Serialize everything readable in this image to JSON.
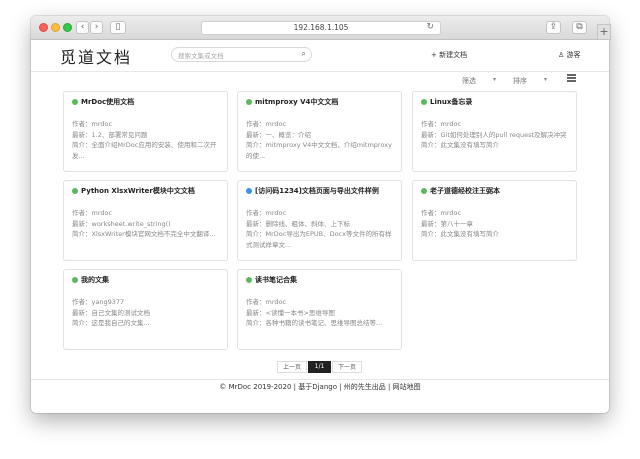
{
  "browser": {
    "url": "192.168.1.105",
    "back_glyph": "‹",
    "forward_glyph": "›",
    "sidebar_glyph": "▯",
    "reload_glyph": "↻",
    "share_glyph": "⇪",
    "tabs_glyph": "⧉",
    "plus_glyph": "+"
  },
  "header": {
    "logo": "觅道文档",
    "search_placeholder": "搜索文集或文档",
    "search_icon": "⌕",
    "new_doc": "+ 新建文档",
    "guest": "♙ 游客"
  },
  "toolbar": {
    "filter_label": "筛选",
    "sort_label": "排序",
    "caret": "▾"
  },
  "cards": [
    {
      "title": "MrDoc使用文档",
      "dot": "green",
      "author": "作者：mrdoc",
      "latest": "最新：1.2、部署常见问题",
      "intro": "简介：全面介绍MrDoc应用的安装、使用和二次开发..."
    },
    {
      "title": "mitmproxy V4中文文档",
      "dot": "green",
      "author": "作者：mrdoc",
      "latest": "最新：一、概览：介绍",
      "intro": "简介：mitmproxy V4中文文档，介绍mitmproxy的使..."
    },
    {
      "title": "Linux备忘录",
      "dot": "green",
      "author": "作者：mrdoc",
      "latest": "最新：Git如何处理别人的pull request及解决冲突",
      "intro": "简介：此文集没有填写简介"
    },
    {
      "title": "Python XlsxWriter模块中文文档",
      "dot": "green",
      "author": "作者：mrdoc",
      "latest": "最新：worksheet.write_string()",
      "intro": "简介：XlsxWriter模块官网文档不完全中文翻译..."
    },
    {
      "title": "[访问码1234]文档页面与导出文件样例",
      "dot": "blue",
      "author": "作者：mrdoc",
      "latest": "最新：删除线、粗体、斜体、上下标",
      "intro": "简介：MrDoc导出为EPUB、Docx等文件的所有样式测试样章文..."
    },
    {
      "title": "老子道德经校注王弼本",
      "dot": "green",
      "author": "作者：mrdoc",
      "latest": "最新：第八十一章",
      "intro": "简介：此文集没有填写简介"
    },
    {
      "title": "我的文集",
      "dot": "green",
      "author": "作者：yang9377",
      "latest": "最新：自己文集的测试文档",
      "intro": "简介：这是我自己的文集..."
    },
    {
      "title": "读书笔记合集",
      "dot": "green",
      "author": "作者：mrdoc",
      "latest": "最新：<读懂一本书>思维导图",
      "intro": "简介：各种书籍的读书笔记、思维导图总结等..."
    }
  ],
  "pagination": {
    "prev": "上一页",
    "current": "1/1",
    "next": "下一页"
  },
  "footer": {
    "text": "© MrDoc 2019-2020 | 基于Django | 州的先生出品 | 网站地图"
  }
}
